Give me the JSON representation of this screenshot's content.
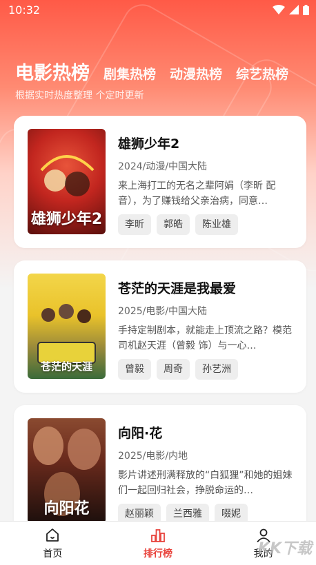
{
  "status_bar": {
    "time": "10:32"
  },
  "header": {
    "tabs": [
      {
        "label": "电影热榜",
        "active": true
      },
      {
        "label": "剧集热榜",
        "active": false
      },
      {
        "label": "动漫热榜",
        "active": false
      },
      {
        "label": "综艺热榜",
        "active": false
      }
    ],
    "subtitle": "根据实时热度整理 个定时更新"
  },
  "items": [
    {
      "title": "雄狮少年2",
      "meta": "2024/动漫/中国大陆",
      "desc": "来上海打工的无名之辈阿娟（李昕 配音），为了赚钱给父亲治病，同意…",
      "actors": [
        "李昕",
        "郭皓",
        "陈业雄"
      ],
      "poster_text": "雄狮少年2",
      "poster_colors": [
        "#c2261f",
        "#5a0f0c"
      ]
    },
    {
      "title": "苍茫的天涯是我最爱",
      "meta": "2025/电影/中国大陆",
      "desc": "手持定制剧本，就能走上顶流之路？模范司机赵天涯（曾毅 饰）与一心…",
      "actors": [
        "曾毅",
        "周奇",
        "孙艺洲"
      ],
      "poster_text": "苍茫的天涯",
      "poster_colors": [
        "#e9c22a",
        "#3b6b3a"
      ]
    },
    {
      "title": "向阳·花",
      "meta": "2025/电影/内地",
      "desc": "影片讲述刑满释放的“白狐狸”和她的姐妹们一起回归社会，挣脱命运的…",
      "actors": [
        "赵丽颖",
        "兰西雅",
        "啜妮"
      ],
      "poster_text": "向阳花",
      "poster_colors": [
        "#6a2a1c",
        "#1c0f0c"
      ]
    }
  ],
  "bottom_nav": [
    {
      "label": "首页",
      "icon": "home-icon",
      "active": false
    },
    {
      "label": "排行榜",
      "icon": "chart-icon",
      "active": true
    },
    {
      "label": "我的",
      "icon": "user-icon",
      "active": false
    }
  ],
  "watermark": "KK下载",
  "colors": {
    "accent": "#e8433c",
    "hero_top": "#ff5a47"
  }
}
